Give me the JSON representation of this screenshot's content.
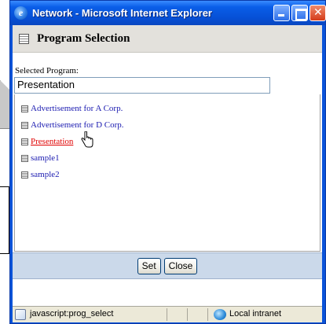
{
  "window": {
    "title": "Network - Microsoft Internet Explorer"
  },
  "header": {
    "title": "Program Selection"
  },
  "selection": {
    "label": "Selected Program:",
    "value": "Presentation"
  },
  "programs": [
    {
      "label": "Advertisement for A Corp."
    },
    {
      "label": "Advertisement for D Corp."
    },
    {
      "label": "Presentation",
      "active": true
    },
    {
      "label": "sample1"
    },
    {
      "label": "sample2"
    }
  ],
  "footer": {
    "set_label": "Set",
    "close_label": "Close"
  },
  "statusbar": {
    "text": "javascript:prog_select",
    "zone": "Local intranet"
  },
  "colors": {
    "link": "#1a1ab0",
    "active_link": "#e00000",
    "title_bar": "#0a5ee8",
    "footer_bg": "#cbd9ea"
  }
}
